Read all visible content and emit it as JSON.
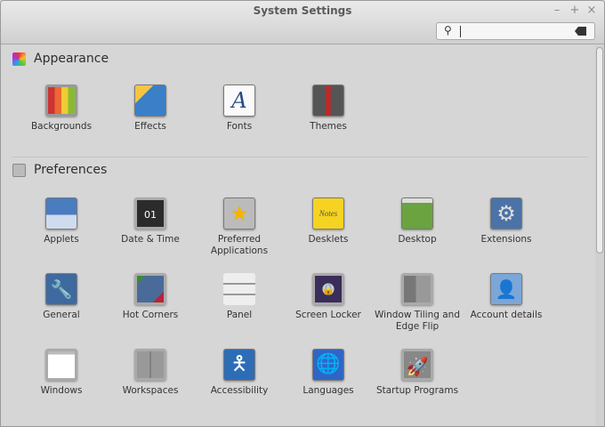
{
  "window": {
    "title": "System Settings",
    "minimize": "–",
    "maximize": "+",
    "close": "×"
  },
  "search": {
    "value": "",
    "icon": "search-icon",
    "clear_icon": "clear-icon"
  },
  "sections": [
    {
      "title": "Appearance",
      "icon": "appearance-icon",
      "items": [
        {
          "label": "Backgrounds",
          "icon": "backgrounds-icon"
        },
        {
          "label": "Effects",
          "icon": "effects-icon"
        },
        {
          "label": "Fonts",
          "icon": "fonts-icon",
          "glyph": "A"
        },
        {
          "label": "Themes",
          "icon": "themes-icon"
        }
      ]
    },
    {
      "title": "Preferences",
      "icon": "preferences-icon",
      "items": [
        {
          "label": "Applets",
          "icon": "applets-icon"
        },
        {
          "label": "Date & Time",
          "icon": "date-time-icon",
          "glyph": "01"
        },
        {
          "label": "Preferred Applications",
          "icon": "preferred-applications-icon",
          "glyph": "★"
        },
        {
          "label": "Desklets",
          "icon": "desklets-icon",
          "glyph": "Notes"
        },
        {
          "label": "Desktop",
          "icon": "desktop-icon"
        },
        {
          "label": "Extensions",
          "icon": "extensions-icon",
          "glyph": "⚙"
        },
        {
          "label": "General",
          "icon": "general-icon",
          "glyph": "🔧"
        },
        {
          "label": "Hot Corners",
          "icon": "hot-corners-icon"
        },
        {
          "label": "Panel",
          "icon": "panel-icon"
        },
        {
          "label": "Screen Locker",
          "icon": "screen-locker-icon",
          "glyph": "🔒"
        },
        {
          "label": "Window Tiling and Edge Flip",
          "icon": "window-tiling-icon"
        },
        {
          "label": "Account details",
          "icon": "account-details-icon",
          "glyph": "👤"
        },
        {
          "label": "Windows",
          "icon": "windows-icon"
        },
        {
          "label": "Workspaces",
          "icon": "workspaces-icon"
        },
        {
          "label": "Accessibility",
          "icon": "accessibility-icon",
          "glyph": "🯅"
        },
        {
          "label": "Languages",
          "icon": "languages-icon",
          "glyph": "🌐"
        },
        {
          "label": "Startup Programs",
          "icon": "startup-programs-icon",
          "glyph": "🚀"
        }
      ]
    }
  ]
}
